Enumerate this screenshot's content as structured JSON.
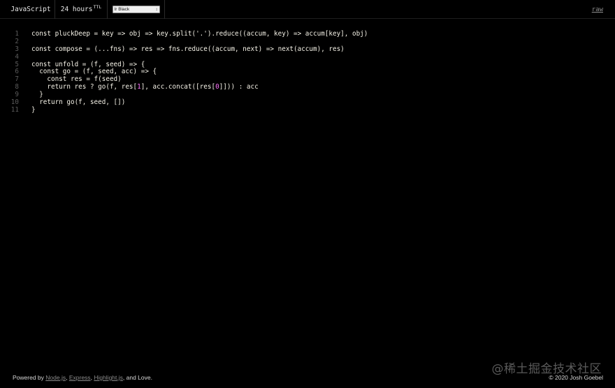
{
  "topbar": {
    "language": "JavaScript",
    "ttl_value": "24 hours",
    "ttl_suffix": "TTL",
    "theme_selected": "Ir Black",
    "raw_link": "raw"
  },
  "code": {
    "lines": [
      {
        "n": "1",
        "segs": [
          {
            "t": "const pluckDeep = key => obj => key.split('.').reduce((accum, key) => accum[key], obj)"
          }
        ]
      },
      {
        "n": "2",
        "segs": [
          {
            "t": ""
          }
        ]
      },
      {
        "n": "3",
        "segs": [
          {
            "t": "const compose = (...fns) => res => fns.reduce((accum, next) => next(accum), res)"
          }
        ]
      },
      {
        "n": "4",
        "segs": [
          {
            "t": ""
          }
        ]
      },
      {
        "n": "5",
        "segs": [
          {
            "t": "const unfold = (f, seed) => {"
          }
        ]
      },
      {
        "n": "6",
        "segs": [
          {
            "t": "  const go = (f, seed, acc) => {"
          }
        ]
      },
      {
        "n": "7",
        "segs": [
          {
            "t": "    const res = f(seed)"
          }
        ]
      },
      {
        "n": "8",
        "segs": [
          {
            "t": "    return res ? go(f, res["
          },
          {
            "t": "1",
            "num": true
          },
          {
            "t": "], acc.concat([res["
          },
          {
            "t": "0",
            "num": true
          },
          {
            "t": "]])) : acc"
          }
        ]
      },
      {
        "n": "9",
        "segs": [
          {
            "t": "  }"
          }
        ]
      },
      {
        "n": "10",
        "segs": [
          {
            "t": "  return go(f, seed, [])"
          }
        ]
      },
      {
        "n": "11",
        "segs": [
          {
            "t": "}"
          }
        ]
      }
    ]
  },
  "footer": {
    "powered_by": "Powered by",
    "link_node": "Node.js",
    "sep1": ",",
    "link_express": "Express",
    "sep2": ",",
    "link_highlight": "Highlight.js",
    "tail": ", and Love.",
    "copyright": "© 2020 Josh Goebel"
  },
  "watermark": "@稀土掘金技术社区",
  "colors": {
    "background": "#000000",
    "text": "#f6f3e8",
    "line_number": "#5b5b5b",
    "number_literal": "#ff73fd",
    "link": "#8a8a8a"
  },
  "icons": {
    "select_arrow": "chevron-updown-icon"
  }
}
